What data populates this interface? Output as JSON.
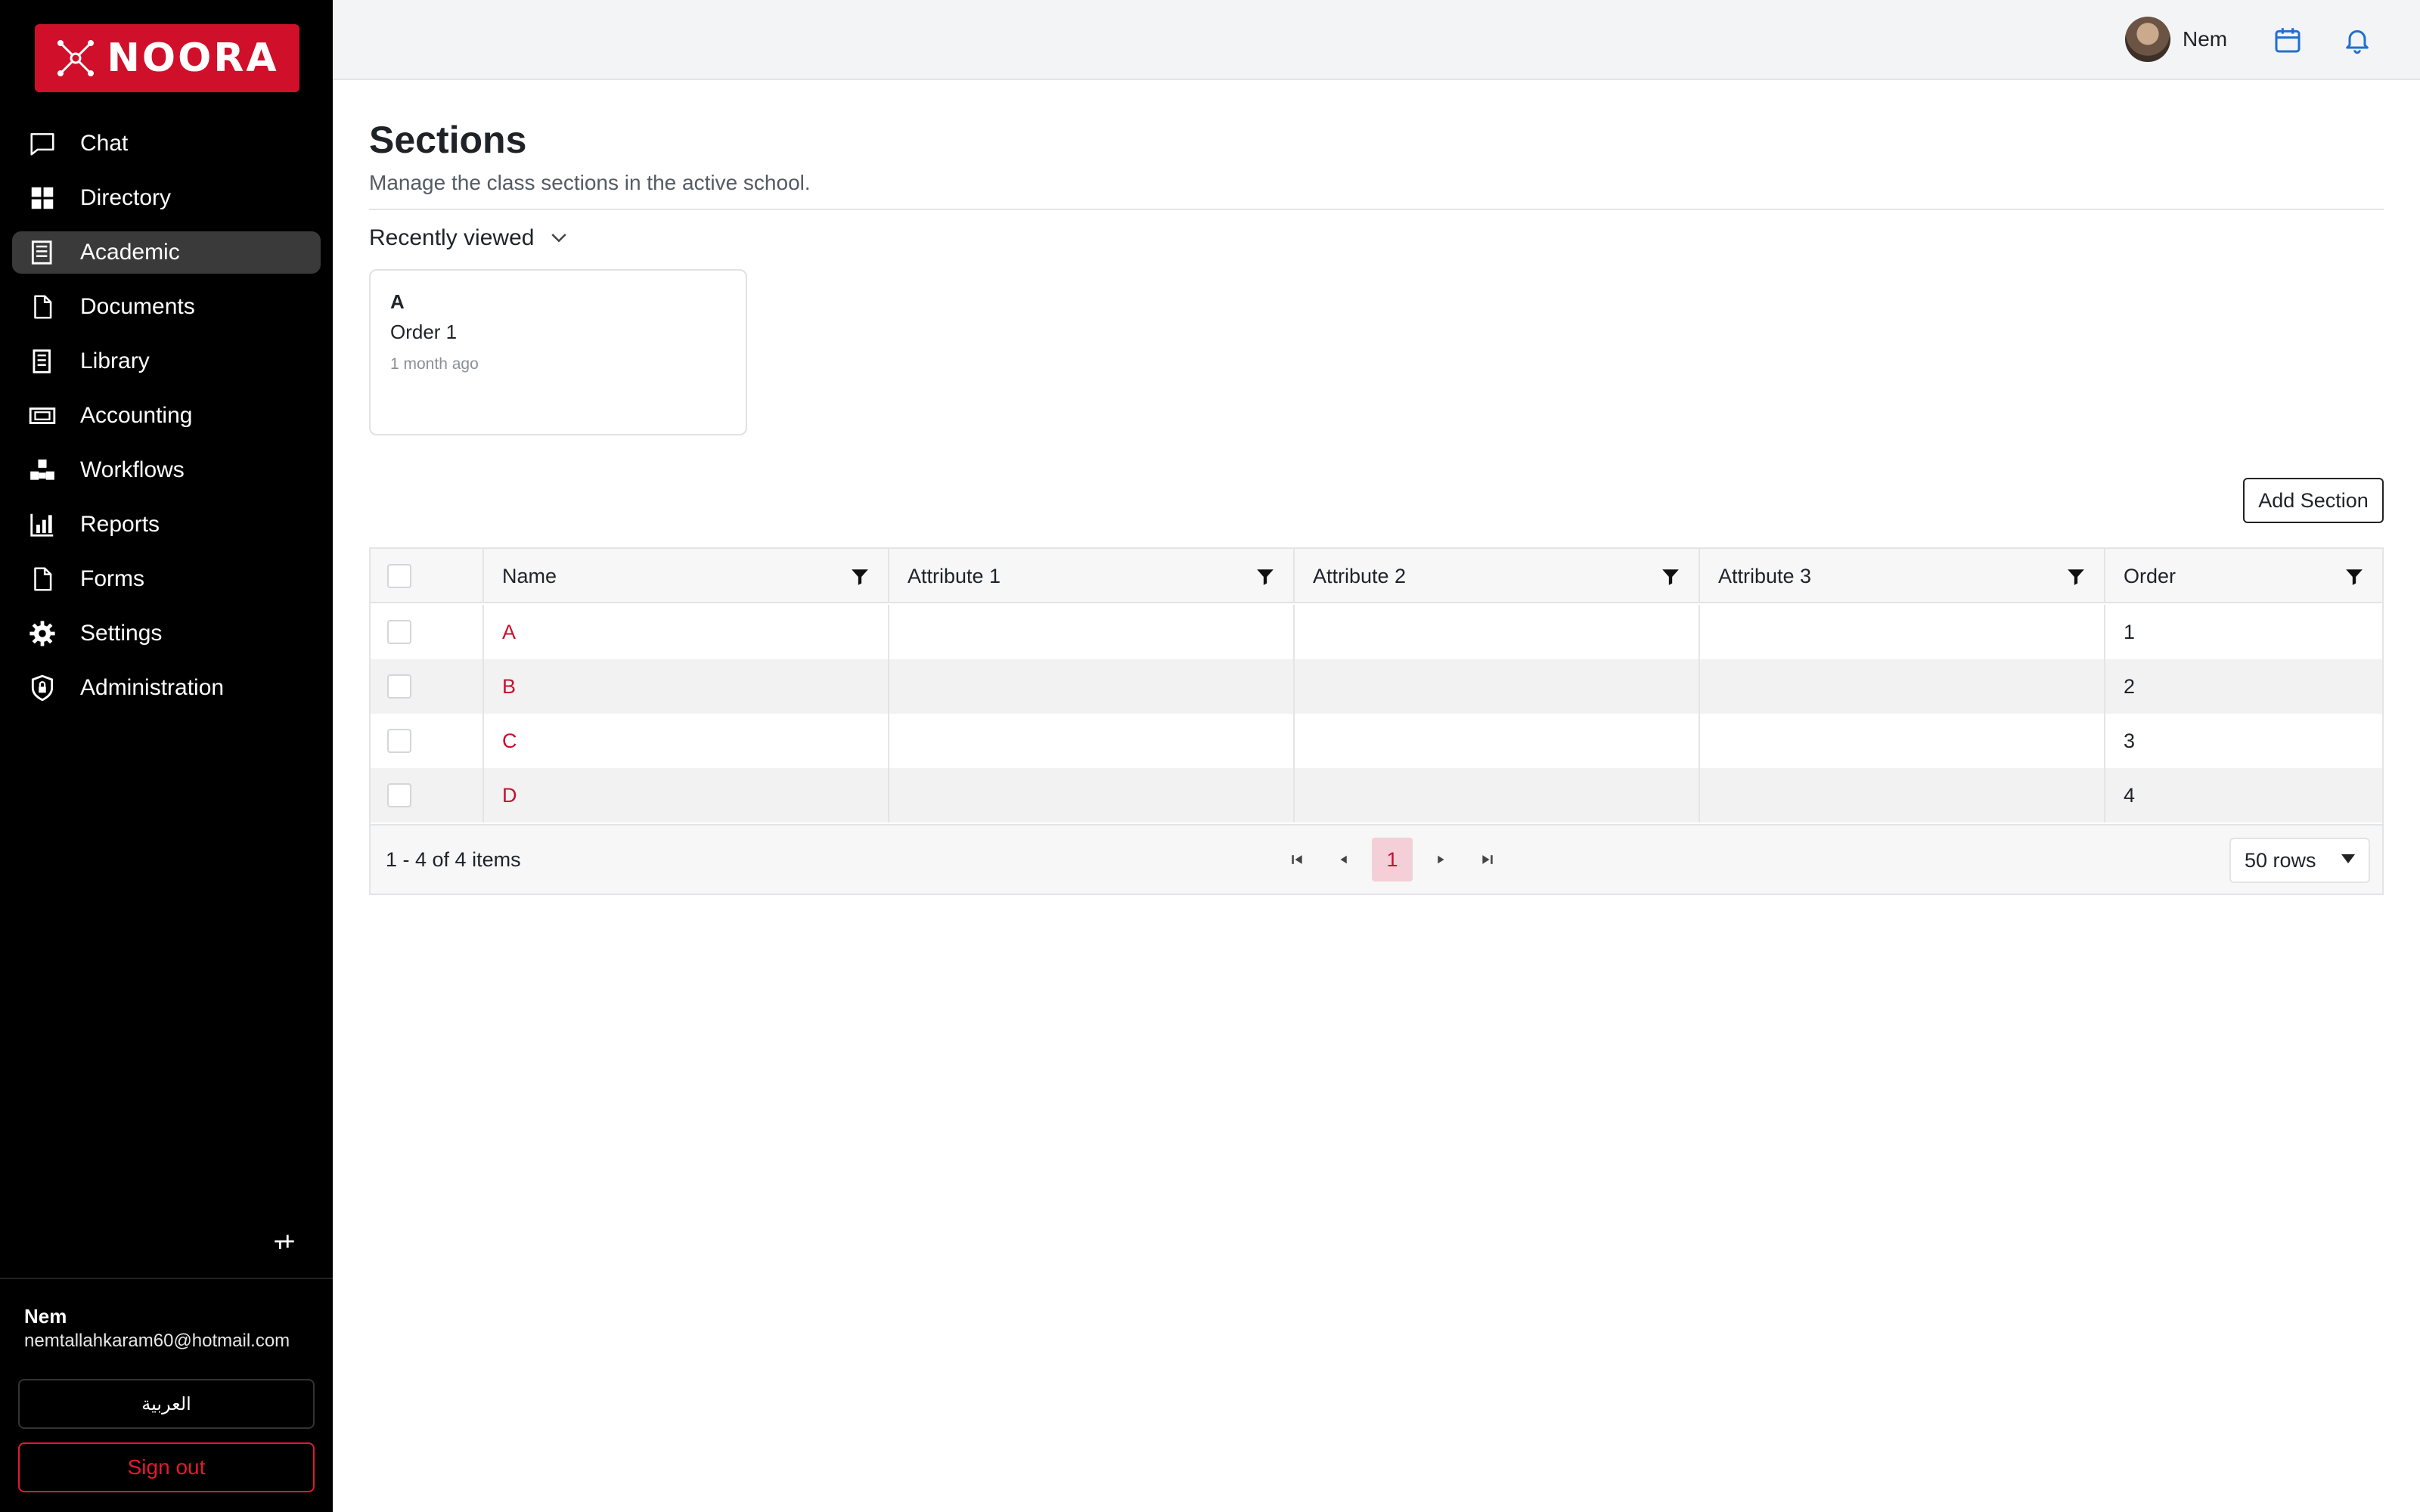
{
  "brand": {
    "name": "NOORA",
    "color": "#d0102a"
  },
  "sidebar": {
    "items": [
      {
        "label": "Chat",
        "icon": "chat-icon"
      },
      {
        "label": "Directory",
        "icon": "grid-icon"
      },
      {
        "label": "Academic",
        "icon": "book-icon",
        "active": true
      },
      {
        "label": "Documents",
        "icon": "document-icon"
      },
      {
        "label": "Library",
        "icon": "library-icon"
      },
      {
        "label": "Accounting",
        "icon": "money-icon"
      },
      {
        "label": "Workflows",
        "icon": "workflow-icon"
      },
      {
        "label": "Reports",
        "icon": "chart-icon"
      },
      {
        "label": "Forms",
        "icon": "form-icon"
      },
      {
        "label": "Settings",
        "icon": "gear-icon"
      },
      {
        "label": "Administration",
        "icon": "shield-icon"
      }
    ],
    "user": {
      "name": "Nem",
      "email": "nemtallahkaram60@hotmail.com"
    },
    "language_button": "العربية",
    "signout_button": "Sign out"
  },
  "topbar": {
    "user_name": "Nem"
  },
  "page": {
    "title": "Sections",
    "description": "Manage the class sections in the active school.",
    "recently_viewed_label": "Recently viewed",
    "recent_card": {
      "title": "A",
      "subtitle": "Order 1",
      "time": "1 month ago"
    },
    "add_button": "Add Section"
  },
  "table": {
    "columns": [
      "Name",
      "Attribute 1",
      "Attribute 2",
      "Attribute 3",
      "Order"
    ],
    "rows": [
      {
        "name": "A",
        "attr1": "",
        "attr2": "",
        "attr3": "",
        "order": "1"
      },
      {
        "name": "B",
        "attr1": "",
        "attr2": "",
        "attr3": "",
        "order": "2"
      },
      {
        "name": "C",
        "attr1": "",
        "attr2": "",
        "attr3": "",
        "order": "3"
      },
      {
        "name": "D",
        "attr1": "",
        "attr2": "",
        "attr3": "",
        "order": "4"
      }
    ],
    "footer": {
      "count_text": "1 - 4 of 4 items",
      "current_page": "1",
      "rows_per_page": "50 rows"
    }
  },
  "colors": {
    "accent": "#c8102e",
    "active_nav": "#3a3a3a",
    "page_highlight": "#f4cfd7",
    "icon_blue": "#1f6fd1"
  }
}
